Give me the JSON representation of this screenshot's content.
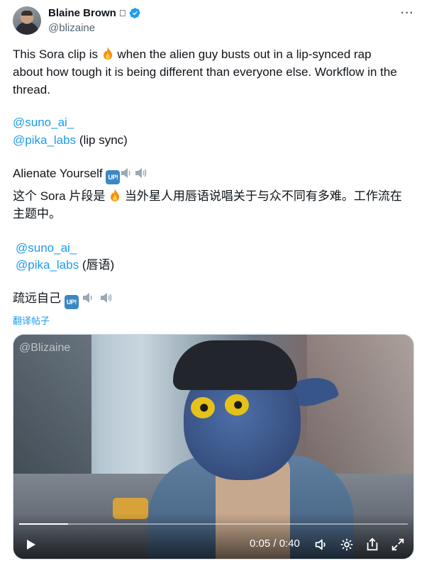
{
  "author": {
    "name": "Blaine Brown",
    "handle": "@blizaine"
  },
  "tweet": {
    "line1": "This Sora clip is ",
    "line1b": " when the alien guy busts out in a lip-synced rap",
    "line2": "about how tough it is being different than everyone else. Workflow in the",
    "line3": "thread.",
    "mention1": "@suno_ai_",
    "mention2": "@pika_labs",
    "mention2_suffix": " (lip sync)",
    "song_title": "Alienate Yourself ",
    "zh_line1a": "这个 Sora 片段是 ",
    "zh_line1b": " 当外星人用唇语说唱关于与众不同有多难。工作流在",
    "zh_line2": "主题中。",
    "zh_mention1": "@suno_ai_",
    "zh_mention2": "@pika_labs",
    "zh_mention2_suffix": " (唇语)",
    "zh_song_title": "疏远自己 ",
    "translate_label": "翻译帖子",
    "up_badge": "UP!"
  },
  "icons": {
    "verified": "verified-badge-icon",
    "more": "more-icon",
    "fire": "fire-emoji-icon",
    "speaker": "speaker-emoji-icon",
    "play": "play-icon",
    "volume": "volume-icon",
    "settings": "settings-icon",
    "share": "share-icon",
    "fullscreen": "fullscreen-icon"
  },
  "video": {
    "watermark": "@Blizaine",
    "time": "0:05 / 0:40",
    "progress": 0.125
  },
  "colors": {
    "link": "#1d9bf0",
    "text": "#0f1419",
    "muted": "#536471",
    "verified": "#1d9bf0"
  }
}
